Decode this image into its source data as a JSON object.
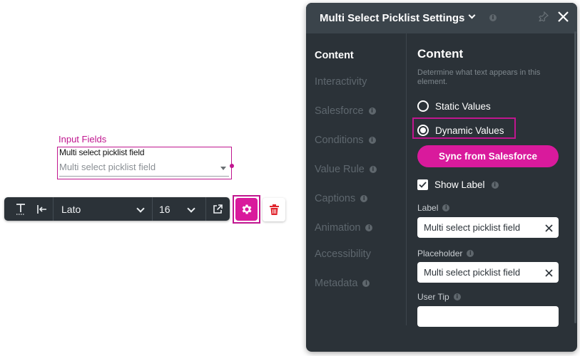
{
  "canvas": {
    "field_tag": "Input Fields",
    "field_label": "Multi select picklist field",
    "field_placeholder": "Multi select picklist field"
  },
  "toolbar": {
    "text_icon": "text-format-icon",
    "align_icon": "align-left-icon",
    "font": "Lato",
    "font_size": "16",
    "open_icon": "external-link-icon",
    "settings_icon": "gear-icon",
    "delete_icon": "trash-icon"
  },
  "panel": {
    "title": "Multi Select Picklist Settings",
    "nav": [
      {
        "label": "Content",
        "active": true
      },
      {
        "label": "Interactivity"
      },
      {
        "label": "Salesforce",
        "info": true
      },
      {
        "label": "Conditions",
        "info": true
      },
      {
        "label": "Value Rule",
        "info": true
      },
      {
        "label": "Captions",
        "info": true
      },
      {
        "label": "Animation",
        "info": true
      },
      {
        "label": "Accessibility"
      },
      {
        "label": "Metadata",
        "info": true
      }
    ],
    "content": {
      "title": "Content",
      "description": "Determine what text appears in this element.",
      "static_values": "Static Values",
      "dynamic_values": "Dynamic Values",
      "selected_option": "Dynamic Values",
      "sync_button": "Sync from Salesforce",
      "show_label": "Show Label",
      "show_label_checked": true,
      "label_field_label": "Label",
      "label_value": "Multi select picklist field",
      "placeholder_field_label": "Placeholder",
      "placeholder_value": "Multi select picklist field",
      "user_tip_label": "User Tip",
      "user_tip_value": ""
    }
  },
  "colors": {
    "accent": "#d91a9c",
    "panel_bg": "#2b3238",
    "panel_header": "#3b444b"
  }
}
